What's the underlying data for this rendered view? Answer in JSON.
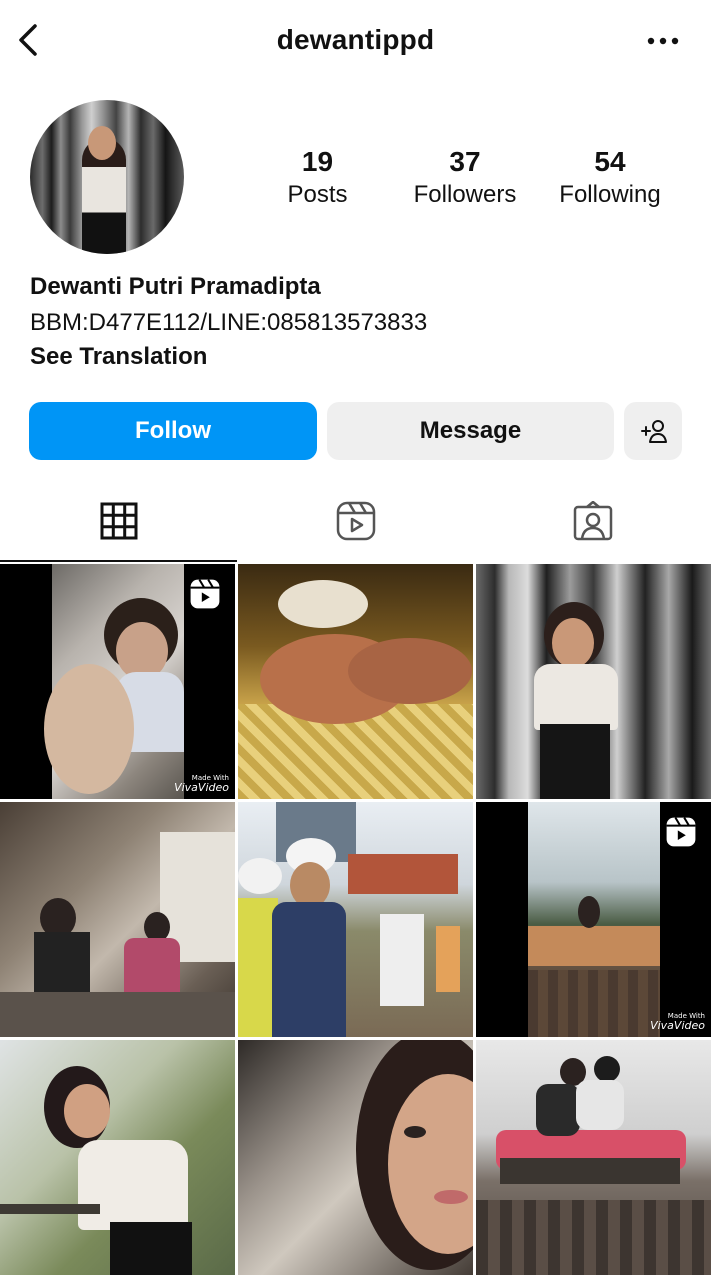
{
  "header": {
    "username": "dewantippd",
    "icons": {
      "back": "back-icon",
      "more": "more-options-icon"
    }
  },
  "profile": {
    "avatar_icon": "profile-avatar",
    "stats": [
      {
        "count": "19",
        "label": "Posts"
      },
      {
        "count": "37",
        "label": "Followers"
      },
      {
        "count": "54",
        "label": "Following"
      }
    ],
    "full_name": "Dewanti Putri Pramadipta",
    "bio": "BBM:D477E112/LINE:085813573833",
    "see_translation": "See Translation"
  },
  "actions": {
    "follow": "Follow",
    "message": "Message",
    "add_user_icon": "add-person-icon"
  },
  "tabs": [
    {
      "icon": "grid-icon",
      "active": true
    },
    {
      "icon": "reels-icon",
      "active": false
    },
    {
      "icon": "tagged-icon",
      "active": false
    }
  ],
  "grid": {
    "watermark_small": "Made With",
    "watermark_big": "VivaVideo",
    "tiles": [
      {
        "name": "post-1",
        "type": "reel"
      },
      {
        "name": "post-2",
        "type": "photo"
      },
      {
        "name": "post-3",
        "type": "photo"
      },
      {
        "name": "post-4",
        "type": "photo"
      },
      {
        "name": "post-5",
        "type": "photo"
      },
      {
        "name": "post-6",
        "type": "reel"
      },
      {
        "name": "post-7",
        "type": "photo"
      },
      {
        "name": "post-8",
        "type": "photo"
      },
      {
        "name": "post-9",
        "type": "photo"
      }
    ]
  },
  "colors": {
    "accent": "#0095f6",
    "button_bg": "#efefef",
    "text": "#111111"
  }
}
